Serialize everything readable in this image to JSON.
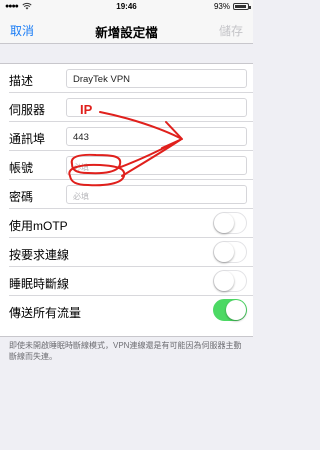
{
  "status_bar": {
    "time": "19:46",
    "battery": "93%",
    "battery_level": 0.93
  },
  "nav": {
    "cancel_label": "取消",
    "title": "新增設定檔",
    "save_label": "儲存"
  },
  "form": {
    "description": {
      "label": "描述",
      "value": "DrayTek VPN"
    },
    "server": {
      "label": "伺服器",
      "value": ""
    },
    "port": {
      "label": "通訊埠",
      "value": "443"
    },
    "account": {
      "label": "帳號",
      "placeholder": "必填"
    },
    "password": {
      "label": "密碼",
      "placeholder": "必填"
    }
  },
  "toggles": [
    {
      "label": "使用mOTP",
      "on": false
    },
    {
      "label": "按要求連線",
      "on": false
    },
    {
      "label": "睡眠時斷線",
      "on": false
    },
    {
      "label": "傳送所有流量",
      "on": true
    }
  ],
  "footer_note": "即使未開啟睡眠時斷線模式，VPN連線還是有可能因為伺服器主動斷線而失連。",
  "annotation": {
    "text": "IP",
    "color": "#e0201c"
  },
  "colors": {
    "accent": "#1a7cf5",
    "toggle_on": "#4cd964",
    "background": "#efeff4"
  }
}
